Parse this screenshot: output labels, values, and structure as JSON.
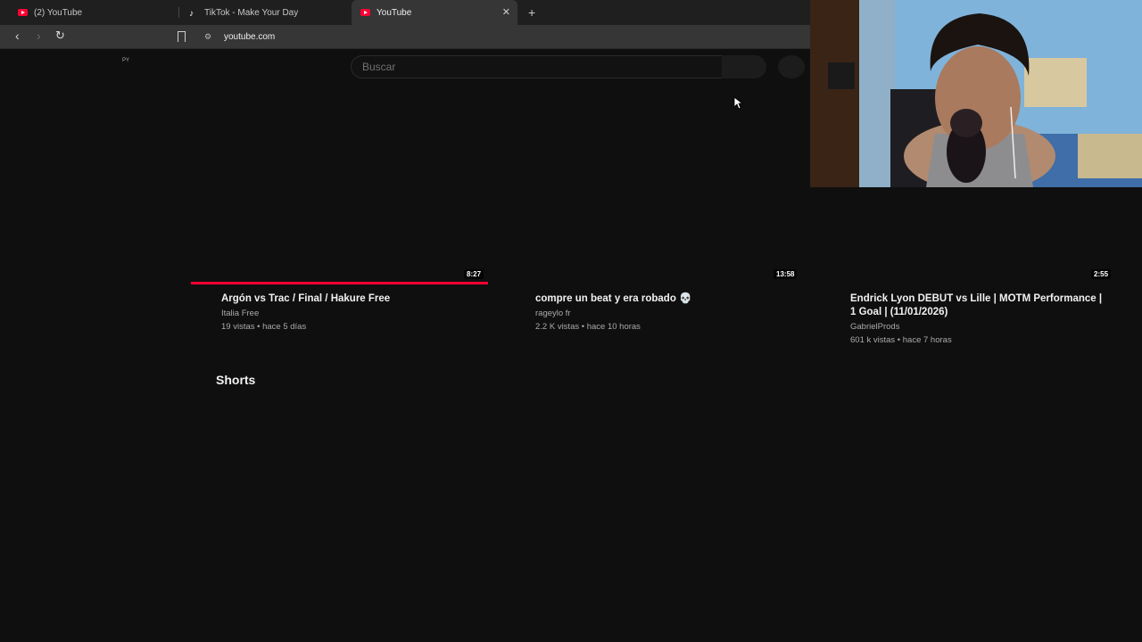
{
  "browser": {
    "tabs": [
      {
        "label": "(2) YouTube",
        "icon": "youtube-icon"
      },
      {
        "label": "TikTok - Make Your Day",
        "icon": "tiktok-icon"
      },
      {
        "label": "YouTube",
        "icon": "youtube-icon",
        "active": true
      }
    ],
    "url": "youtube.com"
  },
  "page": {
    "logo_fragment": "PY",
    "search": {
      "placeholder": "Buscar"
    }
  },
  "videos": [
    {
      "title": "Argón vs Trac / Final / Hakure Free",
      "channel": "Italia Free",
      "stats": "19 vistas • hace 5 días",
      "duration": "8:27",
      "watched_fraction": 1.0
    },
    {
      "title": "compre un beat y era robado 💀",
      "channel": "rageylo fr",
      "stats": "2.2 K vistas • hace 10 horas",
      "duration": "13:58"
    },
    {
      "title_line1": "Endrick Lyon DEBUT vs Lille | MOTM Performance |",
      "title_line2": "1 Goal | (11/01/2026)",
      "channel": "GabrielProds",
      "stats": "601 k vistas • hace 7 horas",
      "duration": "2:55"
    }
  ],
  "sections": {
    "shorts": "Shorts"
  },
  "colors": {
    "background": "#0f0f0f",
    "accent": "#ff0033",
    "tab_strip": "#1f1f1f",
    "toolbar": "#363636"
  }
}
